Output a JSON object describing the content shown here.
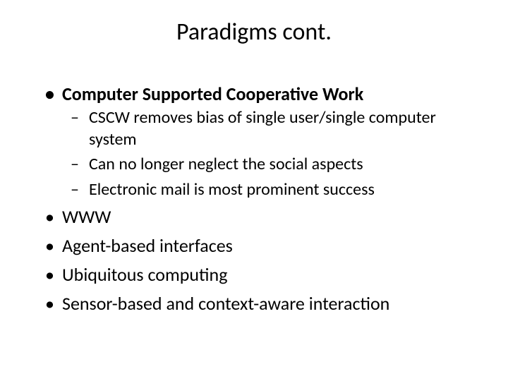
{
  "title": "Paradigms cont.",
  "bullets": {
    "item1": {
      "label": "Computer Supported Cooperative Work",
      "sub1": "CSCW removes bias of single user/single computer system",
      "sub2": "Can no longer neglect the social aspects",
      "sub3": "Electronic mail is most prominent success"
    },
    "item2": "WWW",
    "item3": "Agent-based interfaces",
    "item4": "Ubiquitous computing",
    "item5": "Sensor-based and context-aware interaction"
  }
}
